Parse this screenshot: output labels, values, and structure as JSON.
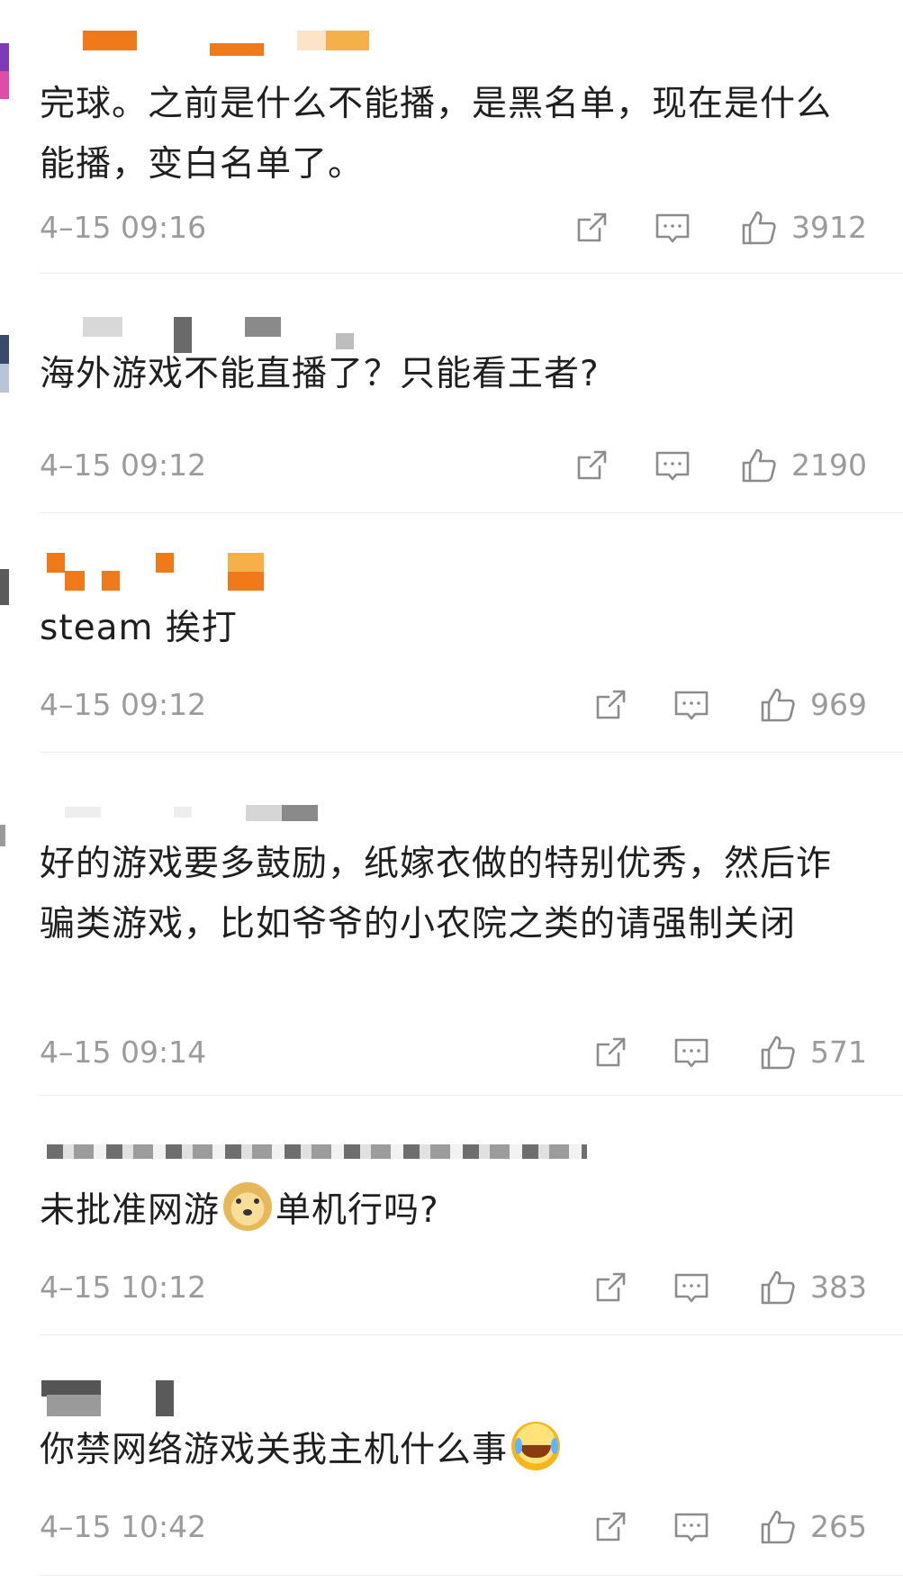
{
  "comments": [
    {
      "text": "完球。之前是什么不能播，是黑名单，现在是什么能播，变白名单了。",
      "time": "4–15 09:16",
      "likes": "3912",
      "emoji": ""
    },
    {
      "text": "海外游戏不能直播了？只能看王者?",
      "time": "4–15 09:12",
      "likes": "2190",
      "emoji": ""
    },
    {
      "text": "steam 挨打",
      "time": "4–15 09:12",
      "likes": "969",
      "emoji": ""
    },
    {
      "text": "好的游戏要多鼓励，纸嫁衣做的特别优秀，然后诈骗类游戏，比如爷爷的小农院之类的请强制关闭",
      "time": "4–15 09:14",
      "likes": "571",
      "emoji": ""
    },
    {
      "text_before": "未批准网游",
      "text_after": "单机行吗?",
      "time": "4–15 10:12",
      "likes": "383",
      "emoji": "doge-emoji"
    },
    {
      "text_before": "你禁网络游戏关我主机什么事",
      "text_after": "",
      "time": "4–15 10:42",
      "likes": "265",
      "emoji": "laugh-cry-emoji"
    }
  ],
  "icons": {
    "share": "share-icon",
    "reply": "comment-icon",
    "like": "thumbs-up-icon"
  },
  "colors": {
    "meta_gray": "#9b9b9b",
    "blur_orange": "#f07a1a",
    "blur_gray": "#8f8f8f"
  }
}
